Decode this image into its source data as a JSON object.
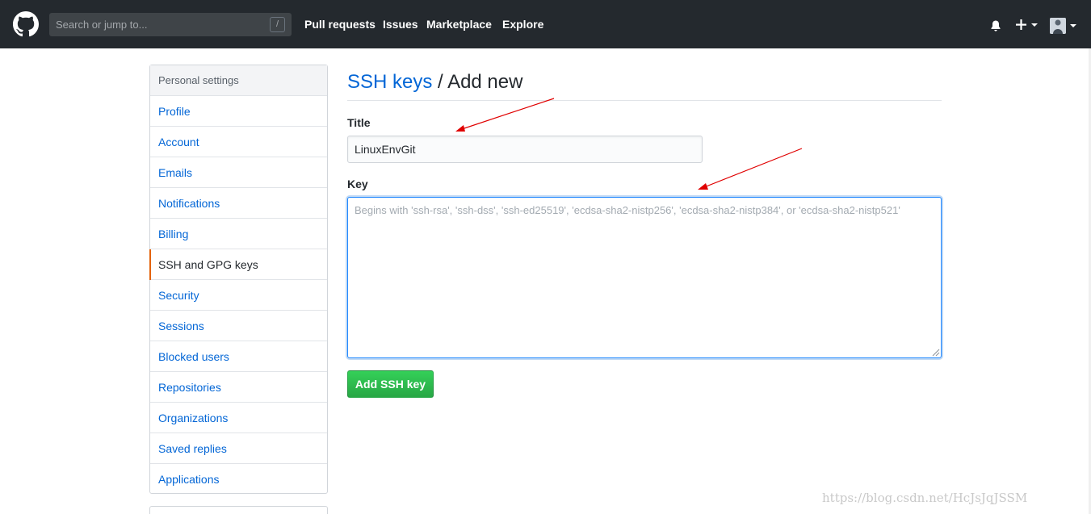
{
  "header": {
    "logo_icon": "github-mark-icon",
    "search": {
      "placeholder": "Search or jump to...",
      "shortcut": "/"
    },
    "nav": [
      {
        "label": "Pull requests"
      },
      {
        "label": "Issues"
      },
      {
        "label": "Marketplace"
      },
      {
        "label": "Explore"
      }
    ],
    "icons": [
      "bell-icon",
      "plus-icon",
      "avatar"
    ]
  },
  "sidebar": {
    "heading": "Personal settings",
    "items": [
      {
        "label": "Profile"
      },
      {
        "label": "Account"
      },
      {
        "label": "Emails"
      },
      {
        "label": "Notifications"
      },
      {
        "label": "Billing"
      },
      {
        "label": "SSH and GPG keys",
        "selected": true
      },
      {
        "label": "Security"
      },
      {
        "label": "Sessions"
      },
      {
        "label": "Blocked users"
      },
      {
        "label": "Repositories"
      },
      {
        "label": "Organizations"
      },
      {
        "label": "Saved replies"
      },
      {
        "label": "Applications"
      }
    ]
  },
  "main": {
    "breadcrumb_link": "SSH keys",
    "separator": " / ",
    "title": "Add new",
    "title_label": "Title",
    "title_value": "LinuxEnvGit",
    "key_label": "Key",
    "key_placeholder": "Begins with 'ssh-rsa', 'ssh-dss', 'ssh-ed25519', 'ecdsa-sha2-nistp256', 'ecdsa-sha2-nistp384', or 'ecdsa-sha2-nistp521'",
    "submit_label": "Add SSH key"
  },
  "watermark": "https://blog.csdn.net/HcJsJqJSSM",
  "colors": {
    "header_bg": "#24292e",
    "link": "#0366d6",
    "selected_marker": "#e36209",
    "button_green": "#28a745",
    "annotation_arrow": "#e00000"
  }
}
